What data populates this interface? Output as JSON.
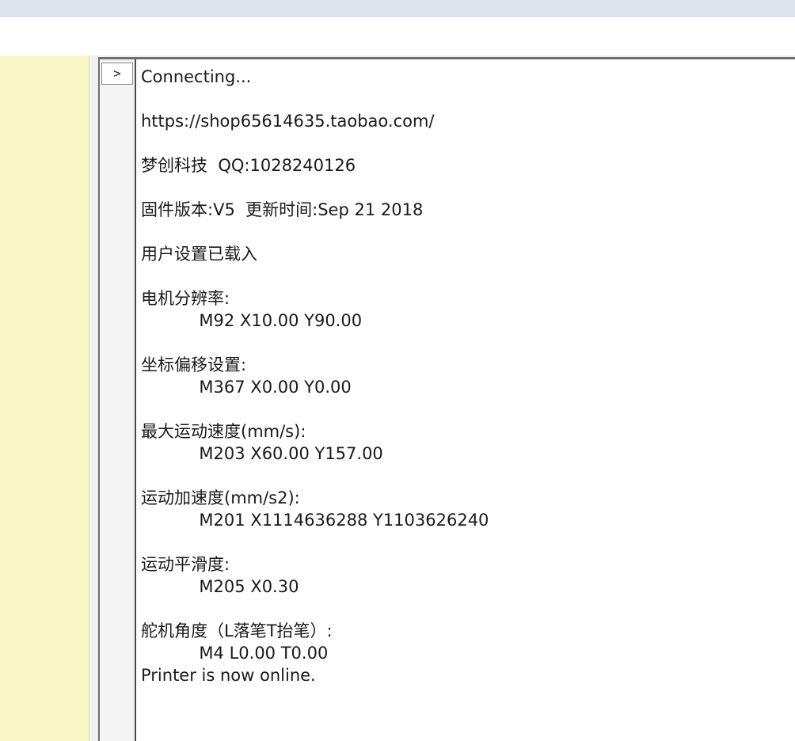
{
  "console": {
    "prompt_label": ">",
    "log_lines": [
      "Connecting...",
      "",
      "https://shop65614635.taobao.com/",
      "",
      "梦创科技  QQ:1028240126",
      "",
      "固件版本:V5  更新时间:Sep 21 2018",
      "",
      "用户设置已载入",
      "",
      "电机分辨率:",
      "           M92 X10.00 Y90.00",
      "",
      "坐标偏移设置:",
      "           M367 X0.00 Y0.00",
      "",
      "最大运动速度(mm/s):",
      "           M203 X60.00 Y157.00",
      "",
      "运动加速度(mm/s2):",
      "           M201 X1114636288 Y1103626240",
      "",
      "运动平滑度:",
      "           M205 X0.30",
      "",
      "舵机角度（L落笔T抬笔）:",
      "           M4 L0.00 T0.00",
      "Printer is now online."
    ]
  }
}
